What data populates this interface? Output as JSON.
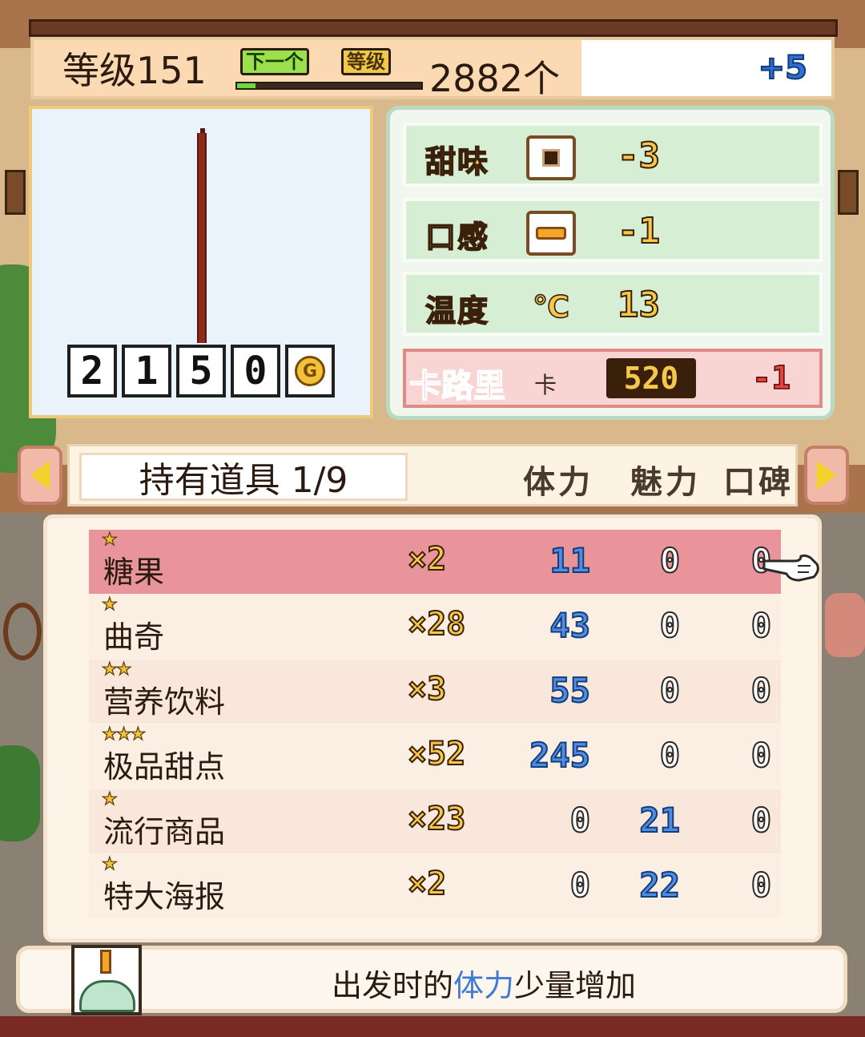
{
  "top_bar": {
    "level_text": "等级151",
    "next_tag": "下一个",
    "level_tag": "等级",
    "exp_progress": 0.1,
    "count_text": "2882个",
    "bonus": "+5"
  },
  "preview": {
    "price_digits": [
      "2",
      "1",
      "5",
      "0"
    ],
    "currency": "G"
  },
  "stats": {
    "rows": [
      {
        "label": "甜味",
        "icon": "square-icon",
        "value": "-3"
      },
      {
        "label": "口感",
        "icon": "pudding-icon",
        "value": "-1"
      },
      {
        "label": "温度",
        "icon": "celsius-icon",
        "icon_text": "℃",
        "value": "13"
      }
    ],
    "calorie": {
      "label": "卡路里",
      "unit": "卡",
      "value": "520",
      "delta": "-1"
    }
  },
  "inventory": {
    "title": "持有道具 1/9",
    "columns": [
      "体力",
      "魅力",
      "口碑"
    ],
    "items": [
      {
        "stars": "★",
        "name": "糖果",
        "qty": "×2",
        "stamina": "11",
        "charm": "0",
        "reputation": "0"
      },
      {
        "stars": "★",
        "name": "曲奇",
        "qty": "×28",
        "stamina": "43",
        "charm": "0",
        "reputation": "0"
      },
      {
        "stars": "★★",
        "name": "营养饮料",
        "qty": "×3",
        "stamina": "55",
        "charm": "0",
        "reputation": "0"
      },
      {
        "stars": "★★★",
        "name": "极品甜点",
        "qty": "×52",
        "stamina": "245",
        "charm": "0",
        "reputation": "0"
      },
      {
        "stars": "★",
        "name": "流行商品",
        "qty": "×23",
        "stamina": "0",
        "charm": "21",
        "reputation": "0"
      },
      {
        "stars": "★",
        "name": "特大海报",
        "qty": "×2",
        "stamina": "0",
        "charm": "22",
        "reputation": "0"
      }
    ]
  },
  "description": {
    "prefix": "出发时的",
    "highlight": "体力",
    "suffix": "少量增加"
  },
  "colors": {
    "accent_yellow": "#f4c94a",
    "selected_row": "#e9949a",
    "highlight_blue": "#3f7ad4"
  }
}
